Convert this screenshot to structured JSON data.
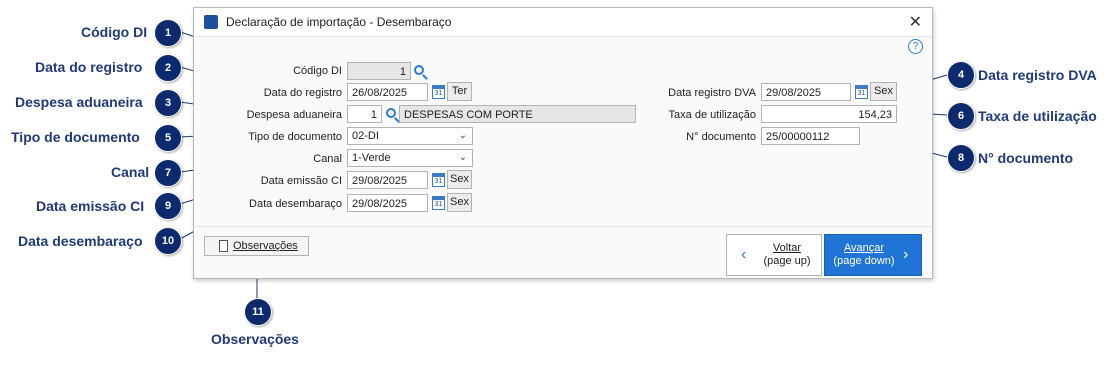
{
  "window": {
    "title": "Declaração de importação - Desembaraço"
  },
  "form": {
    "codigo_di": {
      "label": "Código DI",
      "value": "1"
    },
    "data_registro": {
      "label": "Data do registro",
      "value": "26/08/2025",
      "day": "Ter"
    },
    "despesa": {
      "label": "Despesa aduaneira",
      "code": "1",
      "description": "DESPESAS COM PORTE"
    },
    "tipo_documento": {
      "label": "Tipo de documento",
      "value": "02-DI"
    },
    "canal": {
      "label": "Canal",
      "value": "1-Verde"
    },
    "data_emissao_ci": {
      "label": "Data emissão CI",
      "value": "29/08/2025",
      "day": "Sex"
    },
    "data_desembaraco": {
      "label": "Data desembaraço",
      "value": "29/08/2025",
      "day": "Sex"
    },
    "data_registro_dva": {
      "label": "Data registro DVA",
      "value": "29/08/2025",
      "day": "Sex"
    },
    "taxa_utilizacao": {
      "label": "Taxa de utilização",
      "value": "154,23"
    },
    "n_documento": {
      "label": "N° documento",
      "value": "25/00000112"
    }
  },
  "buttons": {
    "observacoes": "Observações",
    "voltar": [
      "Voltar",
      "(page up)"
    ],
    "avancar": [
      "Avançar",
      "(page down)"
    ]
  },
  "annotations": [
    {
      "n": "1",
      "text": "Código DI"
    },
    {
      "n": "2",
      "text": "Data do registro"
    },
    {
      "n": "3",
      "text": "Despesa aduaneira"
    },
    {
      "n": "4",
      "text": "Data registro DVA"
    },
    {
      "n": "5",
      "text": "Tipo de documento"
    },
    {
      "n": "6",
      "text": "Taxa de utilização"
    },
    {
      "n": "7",
      "text": "Canal"
    },
    {
      "n": "8",
      "text": "N° documento"
    },
    {
      "n": "9",
      "text": "Data emissão CI"
    },
    {
      "n": "10",
      "text": "Data desembaraço"
    },
    {
      "n": "11",
      "text": "Observações"
    }
  ],
  "colors": {
    "accent": "#1f74d6",
    "annotation": "#0d2a6e",
    "annotation_text": "#1f3a78"
  }
}
